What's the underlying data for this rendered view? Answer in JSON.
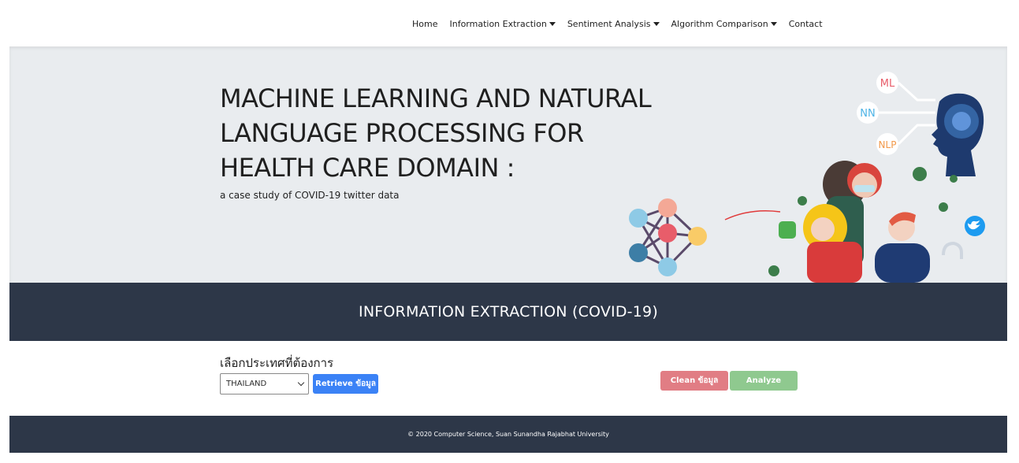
{
  "nav": {
    "items": [
      {
        "label": "Home",
        "dropdown": false
      },
      {
        "label": "Information Extraction",
        "dropdown": true
      },
      {
        "label": "Sentiment Analysis",
        "dropdown": true
      },
      {
        "label": "Algorithm Comparison",
        "dropdown": true
      },
      {
        "label": "Contact",
        "dropdown": false
      }
    ]
  },
  "hero": {
    "title_line1": "MACHINE LEARNING AND NATURAL",
    "title_line2": "LANGUAGE PROCESSING FOR",
    "title_line3": "HEALTH CARE DOMAIN :",
    "subtitle": "a case study of COVID-19 twitter data",
    "art_labels": {
      "ml": "ML",
      "nn": "NN",
      "nlp": "NLP"
    }
  },
  "section": {
    "title": "INFORMATION EXTRACTION (COVID-19)"
  },
  "form": {
    "label": "เลือกประเทศที่ต้องการ",
    "country_selected": "THAILAND",
    "retrieve_label": "Retrieve ข้อมูล",
    "clean_label": "Clean ข้อมูล",
    "analyze_label": "Analyze"
  },
  "footer": {
    "text": "© 2020 Computer Science, Suan Sunandha Rajabhat University"
  },
  "colors": {
    "dark_bar": "#2d3748",
    "hero_bg": "#e9ecef",
    "retrieve": "#3b82f6",
    "clean": "#e17d84",
    "analyze": "#8fc98f"
  }
}
